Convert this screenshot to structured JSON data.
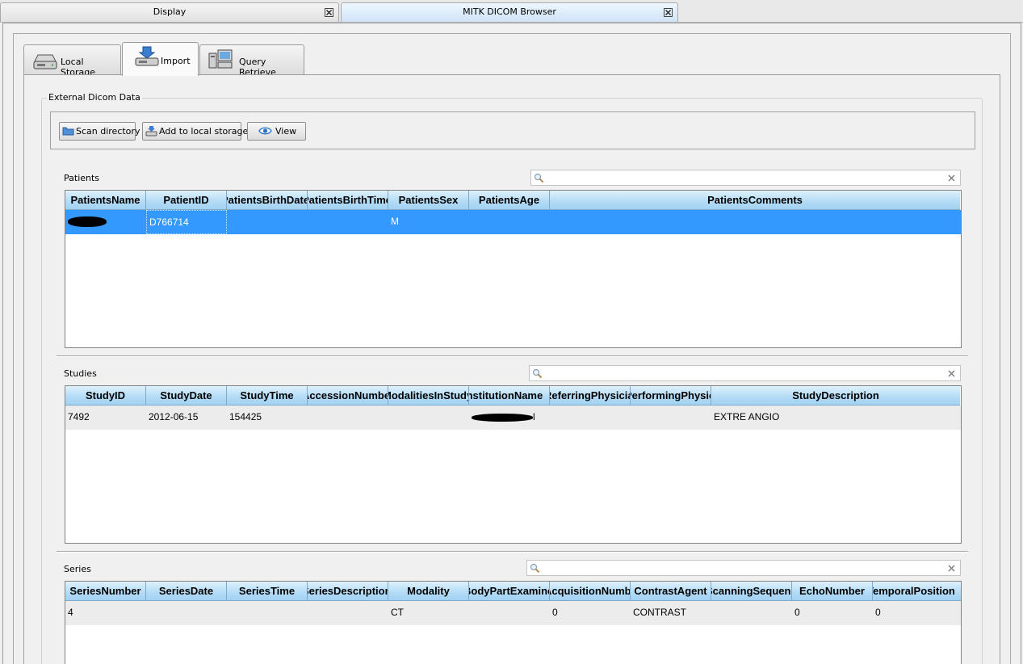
{
  "window": {
    "tabs": [
      {
        "label": "Display",
        "active": false
      },
      {
        "label": "MITK DICOM Browser",
        "active": true
      }
    ]
  },
  "main_tabs": [
    {
      "label": "Local Storage",
      "icon": "hard-drive-icon"
    },
    {
      "label": "Import",
      "icon": "import-download-icon"
    },
    {
      "label": "Query Retrieve",
      "icon": "network-computers-icon"
    }
  ],
  "external": {
    "title": "External Dicom Data",
    "buttons": {
      "scan": "Scan directory",
      "add": "Add to local storage",
      "view": "View"
    }
  },
  "patients": {
    "label": "Patients",
    "search_value": "",
    "columns": [
      "PatientsName",
      "PatientID",
      "PatientsBirthDate",
      "PatientsBirthTime",
      "PatientsSex",
      "PatientsAge",
      "PatientsComments"
    ],
    "rows": [
      {
        "PatientsName": "",
        "PatientID": "D766714",
        "PatientsBirthDate": "",
        "PatientsBirthTime": "",
        "PatientsSex": "M",
        "PatientsAge": "",
        "PatientsComments": ""
      }
    ]
  },
  "studies": {
    "label": "Studies",
    "search_value": "",
    "columns": [
      "StudyID",
      "StudyDate",
      "StudyTime",
      "AccessionNumber",
      "ModalitiesInStudy",
      "InstitutionName",
      "ReferringPhysician",
      "PerformingPhysiciansName",
      "StudyDescription"
    ],
    "rows": [
      {
        "StudyID": "7492",
        "StudyDate": "2012-06-15",
        "StudyTime": "154425",
        "AccessionNumber": "",
        "ModalitiesInStudy": "",
        "InstitutionName": "l",
        "ReferringPhysician": "",
        "PerformingPhysiciansName": "",
        "StudyDescription": "EXTRE ANGIO"
      }
    ]
  },
  "series": {
    "label": "Series",
    "search_value": "",
    "columns": [
      "SeriesNumber",
      "SeriesDate",
      "SeriesTime",
      "SeriesDescription",
      "Modality",
      "BodyPartExamined",
      "AcquisitionNumber",
      "ContrastAgent",
      "ScanningSequence",
      "EchoNumber",
      "TemporalPosition"
    ],
    "rows": [
      {
        "SeriesNumber": "4",
        "SeriesDate": "",
        "SeriesTime": "",
        "SeriesDescription": "",
        "Modality": "CT",
        "BodyPartExamined": "",
        "AcquisitionNumber": "0",
        "ContrastAgent": "CONTRAST",
        "ScanningSequence": "",
        "EchoNumber": "0",
        "TemporalPosition": "0"
      }
    ]
  },
  "colors": {
    "selection": "#3399ff",
    "header_gradient_top": "#dff1fc",
    "header_gradient_bottom": "#9fd0f2"
  }
}
